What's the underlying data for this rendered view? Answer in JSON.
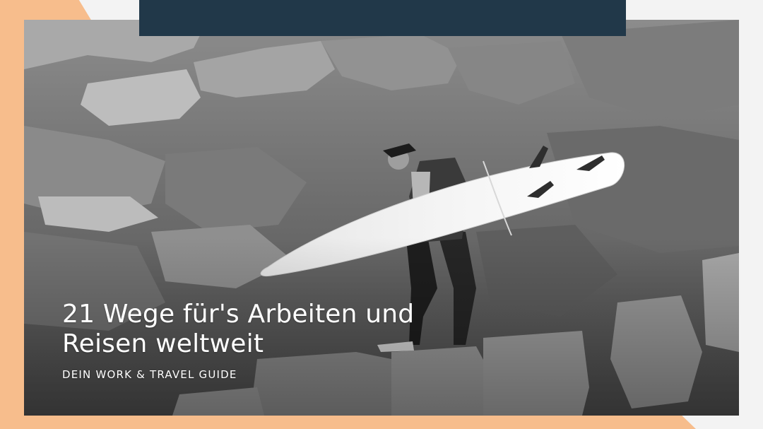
{
  "headline": {
    "line1": "21 Wege für's Arbeiten und",
    "line2": "Reisen weltweit"
  },
  "subheadline": "DEIN WORK & TRAVEL GUIDE",
  "colors": {
    "accent": "#f7bd8c",
    "top_bar": "#213849",
    "text": "#ffffff"
  }
}
